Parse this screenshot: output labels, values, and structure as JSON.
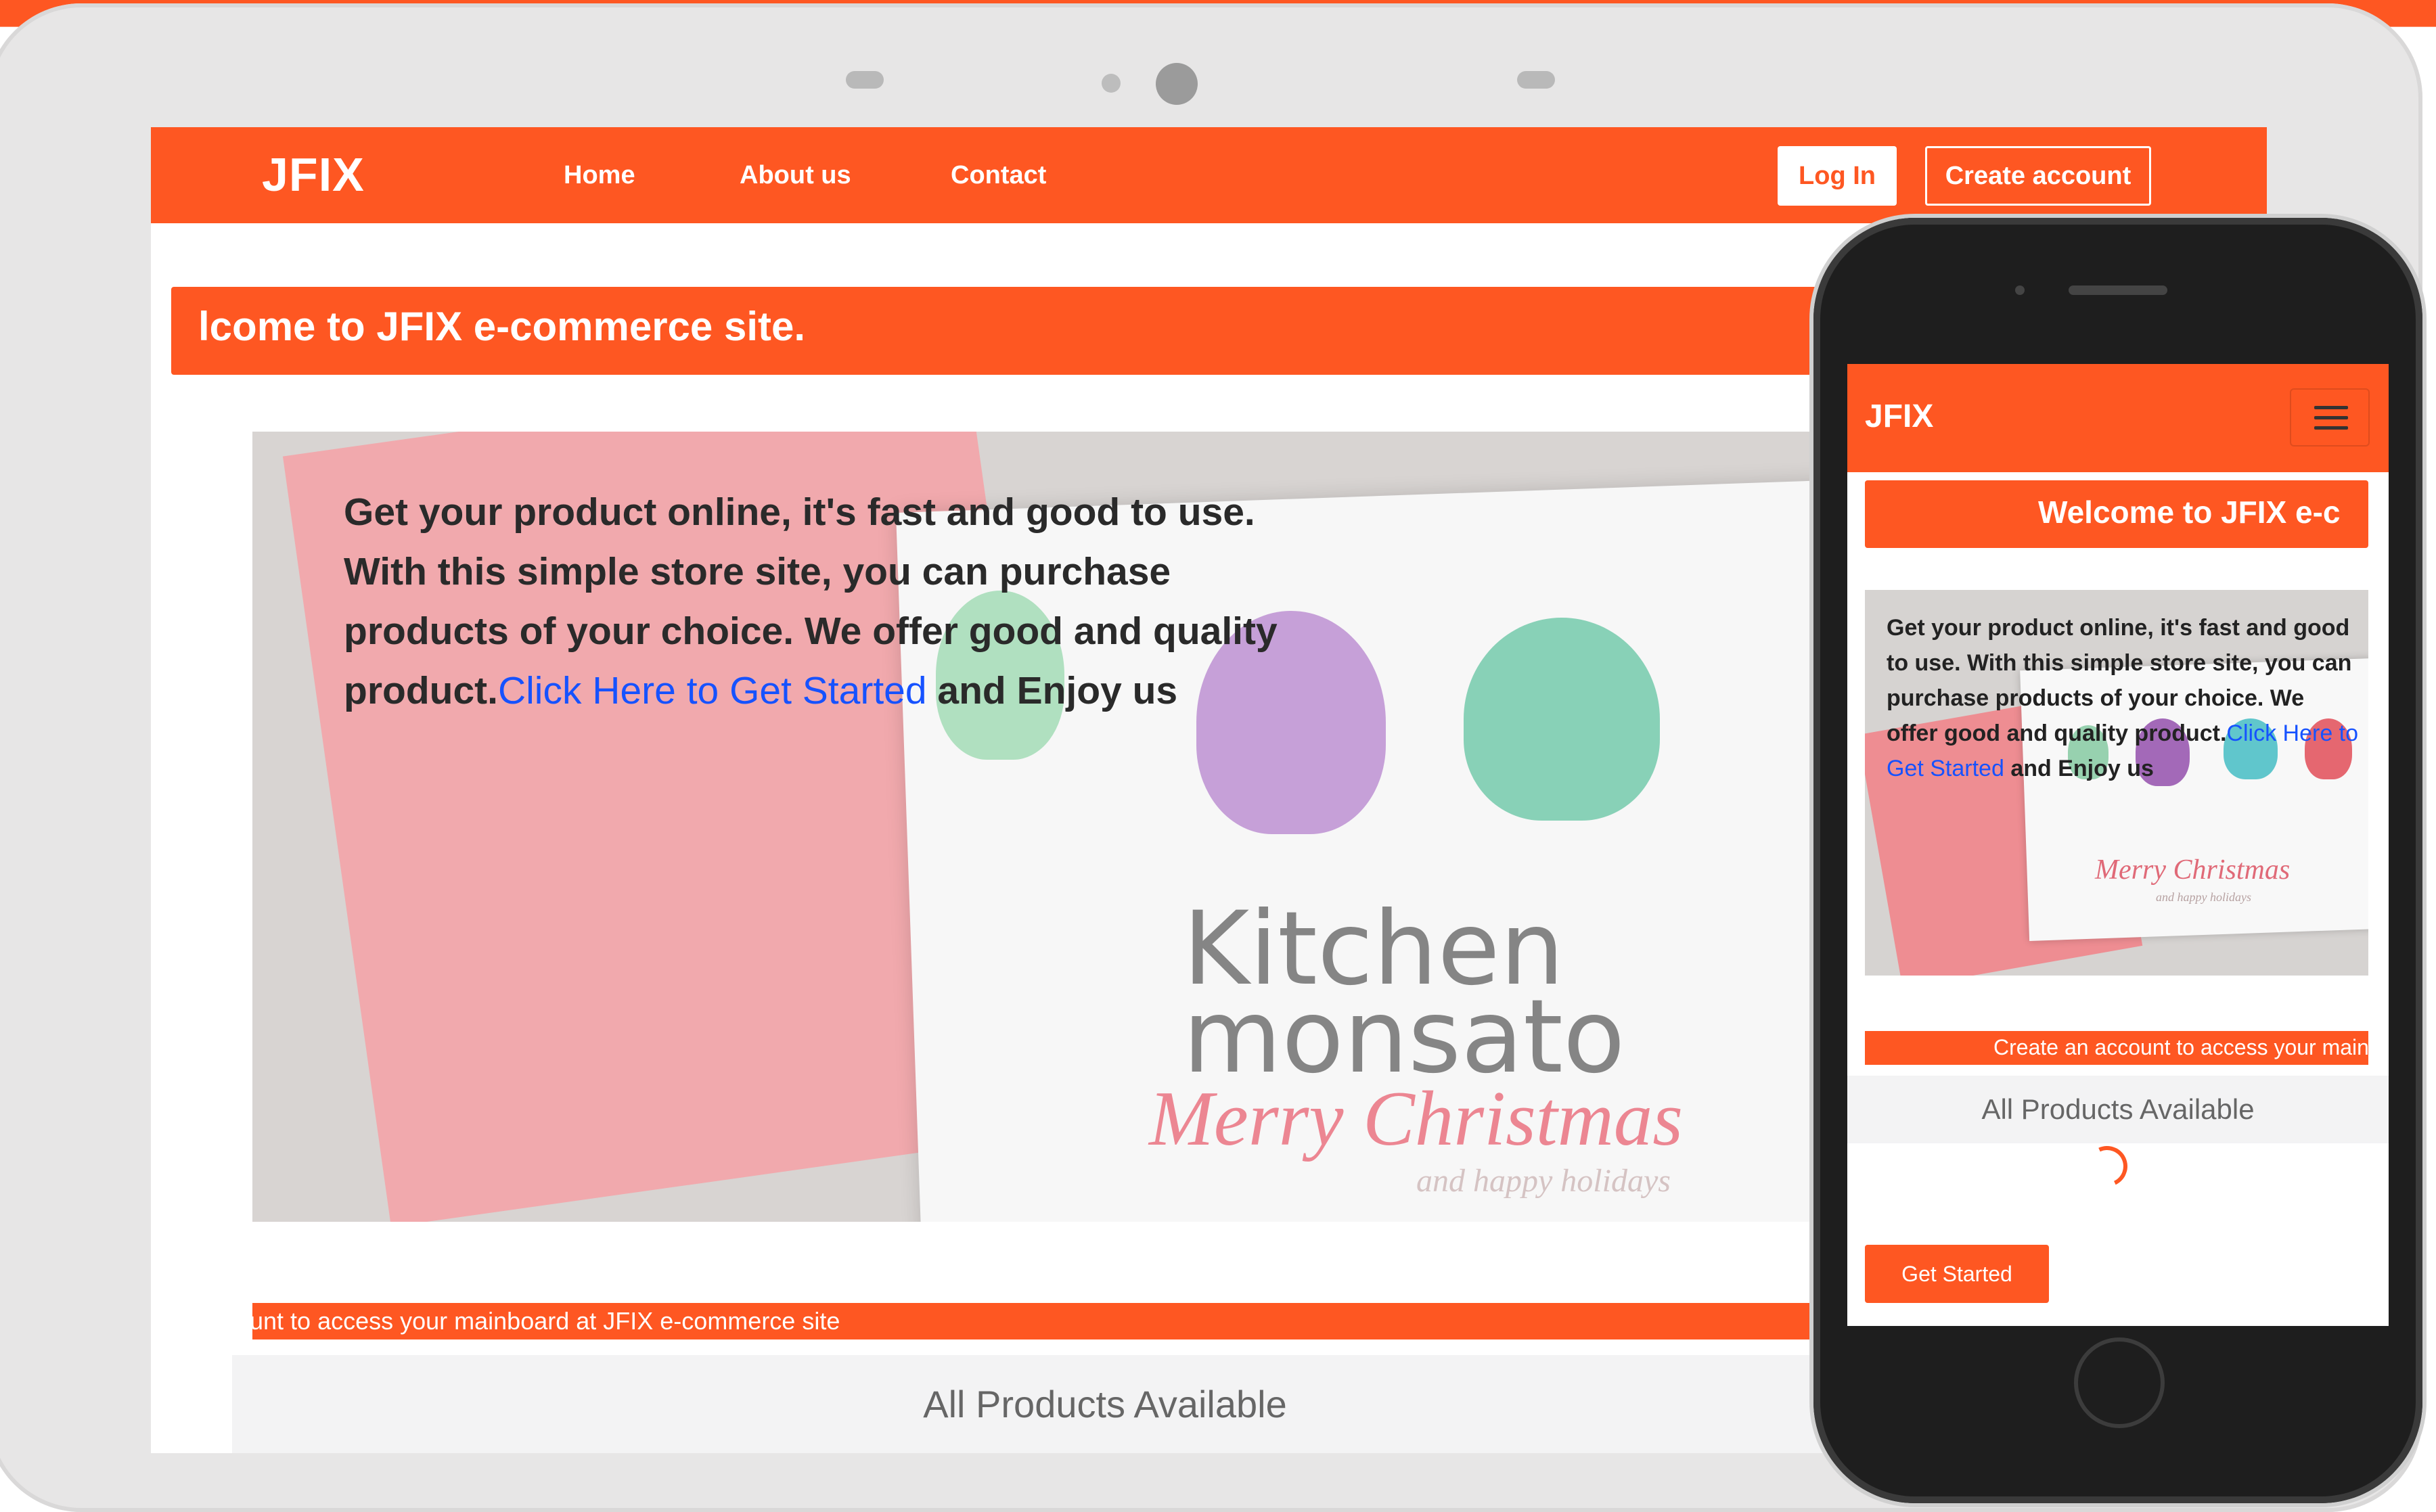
{
  "colors": {
    "brand_orange": "#fe5722",
    "link_blue": "#1652ff",
    "tablet_frame": "#e7e6e6",
    "phone_frame": "#1e1e1e"
  },
  "tablet": {
    "navbar": {
      "brand": "JFIX",
      "links": [
        "Home",
        "About us",
        "Contact"
      ],
      "login_label": "Log In",
      "create_account_label": "Create account"
    },
    "marquee_text": "lcome to JFIX e-commerce site.",
    "hero": {
      "text_before_link": "Get your product online, it's fast and good to use. With this simple store site, you can purchase products of your choice. We offer good and quality product.",
      "link_text": "Click Here to Get Started",
      "text_after_link": " and Enjoy us",
      "logo_line1": "Kitchen",
      "logo_line2": "monsato",
      "logo_tagline": "Merry Christmas",
      "logo_subtagline": "and happy holidays"
    },
    "notice_text": "unt to access your mainboard at JFIX e-commerce site",
    "products_title": "All Products Available"
  },
  "phone": {
    "navbar": {
      "brand": "JFIX",
      "menu_icon": "hamburger-icon"
    },
    "marquee_text": "Welcome to JFIX e-c",
    "hero": {
      "text_before_link": "Get your product online, it's fast and good to use. With this simple store site, you can purchase products of your choice. We offer good and quality product.",
      "link_text": "Click Here to Get Started",
      "text_after_link": " and Enjoy us",
      "logo_tagline": "Merry Christmas",
      "logo_subtagline": "and happy holidays"
    },
    "notice_text": "Create an account to access your maint",
    "products_title": "All Products Available",
    "loading_icon": "spinner-icon",
    "get_started_label": "Get Started"
  }
}
